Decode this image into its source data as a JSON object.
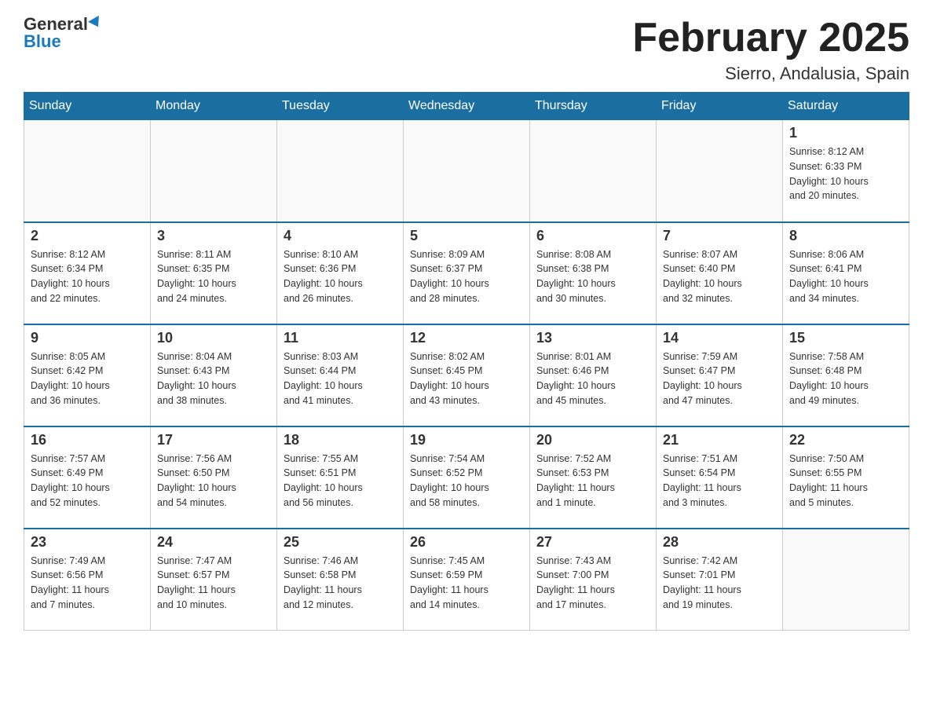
{
  "header": {
    "logo_general": "General",
    "logo_blue": "Blue",
    "month_title": "February 2025",
    "location": "Sierro, Andalusia, Spain"
  },
  "days_of_week": [
    "Sunday",
    "Monday",
    "Tuesday",
    "Wednesday",
    "Thursday",
    "Friday",
    "Saturday"
  ],
  "weeks": [
    [
      {
        "day": "",
        "info": ""
      },
      {
        "day": "",
        "info": ""
      },
      {
        "day": "",
        "info": ""
      },
      {
        "day": "",
        "info": ""
      },
      {
        "day": "",
        "info": ""
      },
      {
        "day": "",
        "info": ""
      },
      {
        "day": "1",
        "info": "Sunrise: 8:12 AM\nSunset: 6:33 PM\nDaylight: 10 hours\nand 20 minutes."
      }
    ],
    [
      {
        "day": "2",
        "info": "Sunrise: 8:12 AM\nSunset: 6:34 PM\nDaylight: 10 hours\nand 22 minutes."
      },
      {
        "day": "3",
        "info": "Sunrise: 8:11 AM\nSunset: 6:35 PM\nDaylight: 10 hours\nand 24 minutes."
      },
      {
        "day": "4",
        "info": "Sunrise: 8:10 AM\nSunset: 6:36 PM\nDaylight: 10 hours\nand 26 minutes."
      },
      {
        "day": "5",
        "info": "Sunrise: 8:09 AM\nSunset: 6:37 PM\nDaylight: 10 hours\nand 28 minutes."
      },
      {
        "day": "6",
        "info": "Sunrise: 8:08 AM\nSunset: 6:38 PM\nDaylight: 10 hours\nand 30 minutes."
      },
      {
        "day": "7",
        "info": "Sunrise: 8:07 AM\nSunset: 6:40 PM\nDaylight: 10 hours\nand 32 minutes."
      },
      {
        "day": "8",
        "info": "Sunrise: 8:06 AM\nSunset: 6:41 PM\nDaylight: 10 hours\nand 34 minutes."
      }
    ],
    [
      {
        "day": "9",
        "info": "Sunrise: 8:05 AM\nSunset: 6:42 PM\nDaylight: 10 hours\nand 36 minutes."
      },
      {
        "day": "10",
        "info": "Sunrise: 8:04 AM\nSunset: 6:43 PM\nDaylight: 10 hours\nand 38 minutes."
      },
      {
        "day": "11",
        "info": "Sunrise: 8:03 AM\nSunset: 6:44 PM\nDaylight: 10 hours\nand 41 minutes."
      },
      {
        "day": "12",
        "info": "Sunrise: 8:02 AM\nSunset: 6:45 PM\nDaylight: 10 hours\nand 43 minutes."
      },
      {
        "day": "13",
        "info": "Sunrise: 8:01 AM\nSunset: 6:46 PM\nDaylight: 10 hours\nand 45 minutes."
      },
      {
        "day": "14",
        "info": "Sunrise: 7:59 AM\nSunset: 6:47 PM\nDaylight: 10 hours\nand 47 minutes."
      },
      {
        "day": "15",
        "info": "Sunrise: 7:58 AM\nSunset: 6:48 PM\nDaylight: 10 hours\nand 49 minutes."
      }
    ],
    [
      {
        "day": "16",
        "info": "Sunrise: 7:57 AM\nSunset: 6:49 PM\nDaylight: 10 hours\nand 52 minutes."
      },
      {
        "day": "17",
        "info": "Sunrise: 7:56 AM\nSunset: 6:50 PM\nDaylight: 10 hours\nand 54 minutes."
      },
      {
        "day": "18",
        "info": "Sunrise: 7:55 AM\nSunset: 6:51 PM\nDaylight: 10 hours\nand 56 minutes."
      },
      {
        "day": "19",
        "info": "Sunrise: 7:54 AM\nSunset: 6:52 PM\nDaylight: 10 hours\nand 58 minutes."
      },
      {
        "day": "20",
        "info": "Sunrise: 7:52 AM\nSunset: 6:53 PM\nDaylight: 11 hours\nand 1 minute."
      },
      {
        "day": "21",
        "info": "Sunrise: 7:51 AM\nSunset: 6:54 PM\nDaylight: 11 hours\nand 3 minutes."
      },
      {
        "day": "22",
        "info": "Sunrise: 7:50 AM\nSunset: 6:55 PM\nDaylight: 11 hours\nand 5 minutes."
      }
    ],
    [
      {
        "day": "23",
        "info": "Sunrise: 7:49 AM\nSunset: 6:56 PM\nDaylight: 11 hours\nand 7 minutes."
      },
      {
        "day": "24",
        "info": "Sunrise: 7:47 AM\nSunset: 6:57 PM\nDaylight: 11 hours\nand 10 minutes."
      },
      {
        "day": "25",
        "info": "Sunrise: 7:46 AM\nSunset: 6:58 PM\nDaylight: 11 hours\nand 12 minutes."
      },
      {
        "day": "26",
        "info": "Sunrise: 7:45 AM\nSunset: 6:59 PM\nDaylight: 11 hours\nand 14 minutes."
      },
      {
        "day": "27",
        "info": "Sunrise: 7:43 AM\nSunset: 7:00 PM\nDaylight: 11 hours\nand 17 minutes."
      },
      {
        "day": "28",
        "info": "Sunrise: 7:42 AM\nSunset: 7:01 PM\nDaylight: 11 hours\nand 19 minutes."
      },
      {
        "day": "",
        "info": ""
      }
    ]
  ]
}
